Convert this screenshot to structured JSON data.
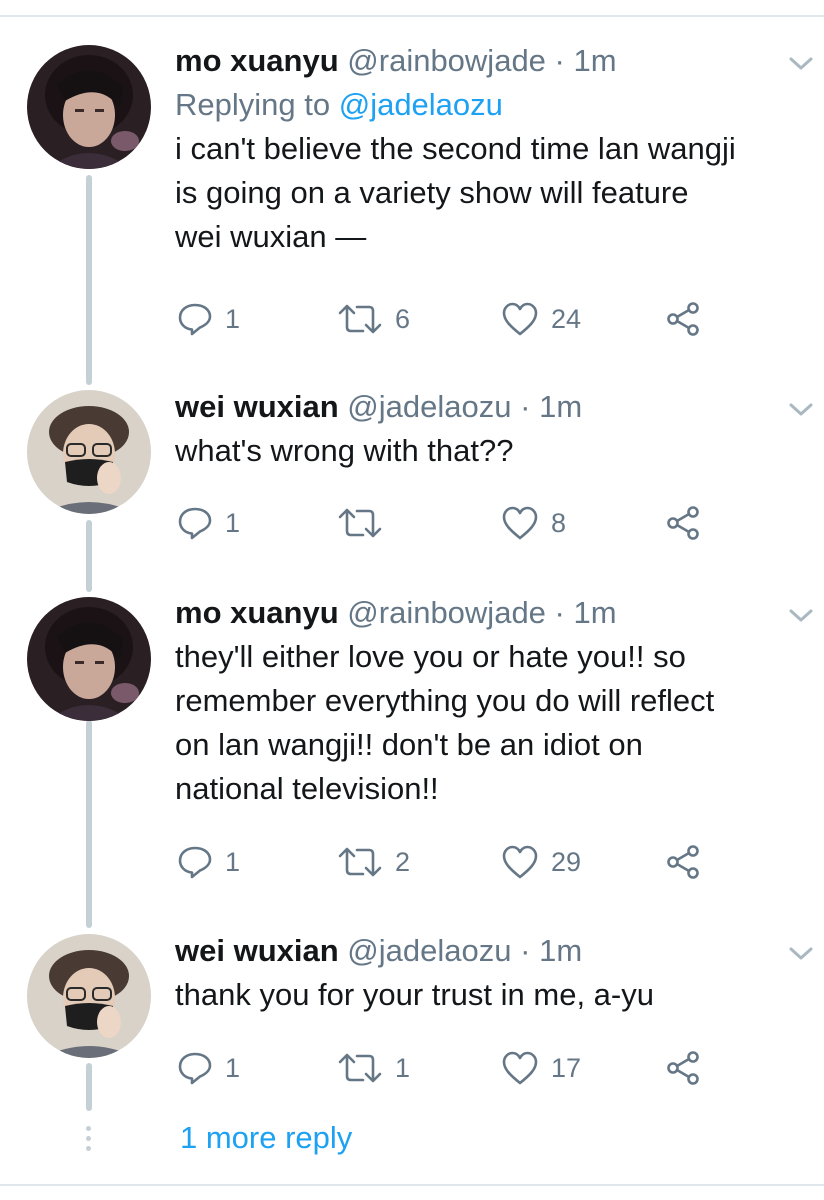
{
  "tweets": [
    {
      "name": "mo xuanyu",
      "handle": "@rainbowjade",
      "separator": "·",
      "time": "1m",
      "replying_label": "Replying to",
      "replying_to": "@jadelaozu",
      "lines": [
        "i can't believe the second time lan wangji",
        "is going on a variety show will feature",
        "wei wuxian —"
      ],
      "replies": "1",
      "retweets": "6",
      "likes": "24"
    },
    {
      "name": "wei wuxian",
      "handle": "@jadelaozu",
      "separator": "·",
      "time": "1m",
      "lines": [
        "what's wrong with that??"
      ],
      "replies": "1",
      "retweets": "",
      "likes": "8"
    },
    {
      "name": "mo xuanyu",
      "handle": "@rainbowjade",
      "separator": "·",
      "time": "1m",
      "lines": [
        "they'll either love you or hate you!! so",
        "remember everything you do will reflect",
        "on lan wangji!! don't be an idiot on",
        "national television!!"
      ],
      "replies": "1",
      "retweets": "2",
      "likes": "29"
    },
    {
      "name": "wei wuxian",
      "handle": "@jadelaozu",
      "separator": "·",
      "time": "1m",
      "lines": [
        "thank you for your trust in me, a-yu"
      ],
      "replies": "1",
      "retweets": "1",
      "likes": "17"
    }
  ],
  "more_replies": "1 more reply",
  "icons": {
    "reply": "reply-icon",
    "retweet": "retweet-icon",
    "like": "heart-icon",
    "share": "share-icon",
    "caret": "chevron-down-icon"
  },
  "colors": {
    "text": "#14171a",
    "secondary": "#657786",
    "link": "#1da1f2",
    "thread_line": "#c4cfd6"
  }
}
